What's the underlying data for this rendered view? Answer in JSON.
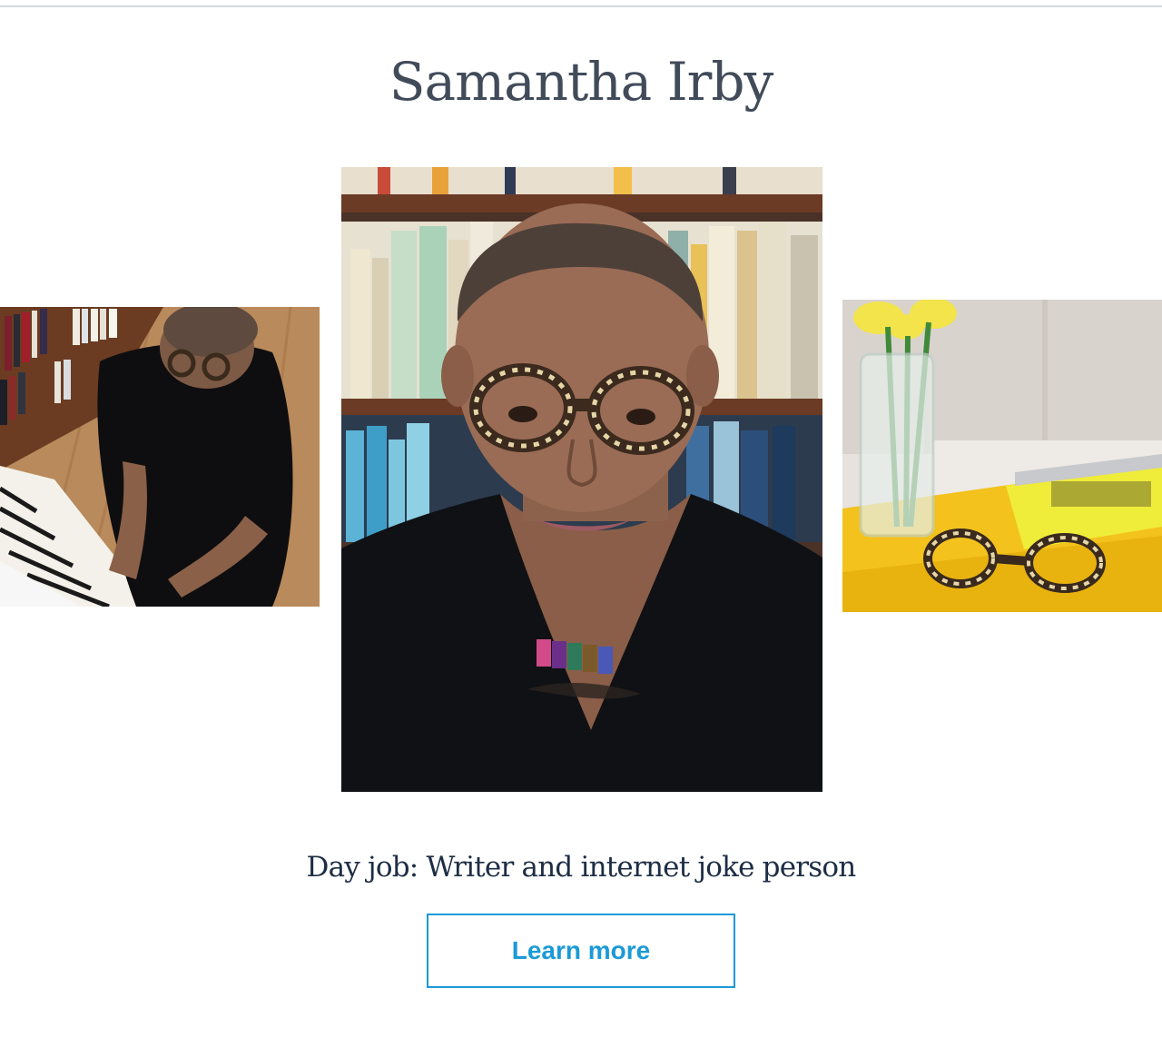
{
  "profile": {
    "name": "Samantha Irby",
    "day_job": "Day job: Writer and internet joke person",
    "cta_label": "Learn more"
  },
  "photos": [
    {
      "name": "photo-playing-piano",
      "alt": "Samantha Irby playing piano"
    },
    {
      "name": "photo-portrait",
      "alt": "Samantha Irby portrait"
    },
    {
      "name": "photo-glasses-on-table",
      "alt": "Tortoiseshell glasses on yellow table"
    }
  ],
  "colors": {
    "title": "#414b5a",
    "body_text": "#1d2d44",
    "accent": "#1b9ad6",
    "divider": "#d6d8db"
  }
}
